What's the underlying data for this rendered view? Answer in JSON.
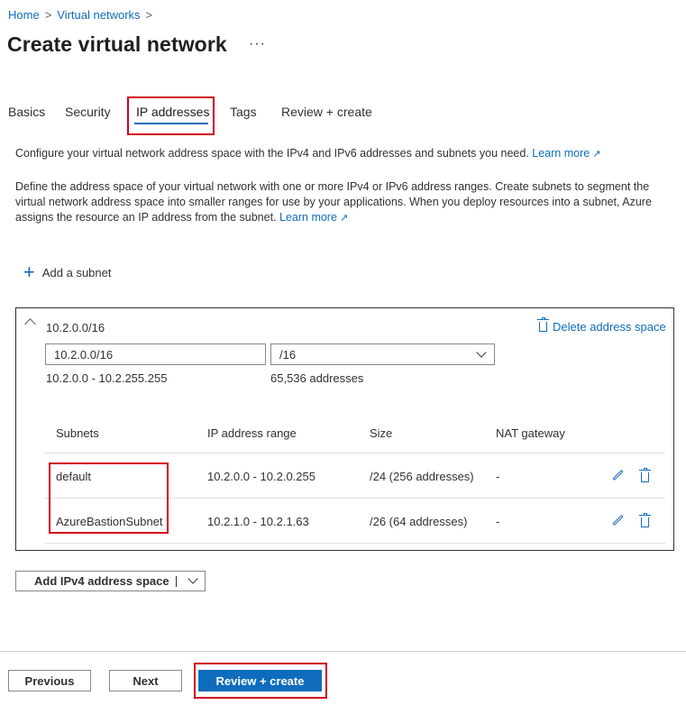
{
  "breadcrumb": {
    "home": "Home",
    "virtual_networks": "Virtual networks",
    "sep": ">"
  },
  "page": {
    "title": "Create virtual network",
    "more": "···"
  },
  "tabs": [
    {
      "label": "Basics",
      "active": false
    },
    {
      "label": "Security",
      "active": false
    },
    {
      "label": "IP addresses",
      "active": true
    },
    {
      "label": "Tags",
      "active": false
    },
    {
      "label": "Review + create",
      "active": false
    }
  ],
  "description": {
    "line1": "Configure your virtual network address space with the IPv4 and IPv6 addresses and subnets you need.",
    "line2": "Define the address space of your virtual network with one or more IPv4 or IPv6 address ranges. Create subnets to segment the virtual network address space into smaller ranges for use by your applications. When you deploy resources into a subnet, Azure assigns the resource an IP address from the subnet.",
    "learn_more": "Learn more"
  },
  "add_subnet": {
    "label": "Add a subnet",
    "icon": "plus-icon"
  },
  "address_space": {
    "header": "10.2.0.0/16",
    "delete_label": "Delete address space",
    "address_value": "10.2.0.0/16",
    "prefix_value": "/16",
    "range": "10.2.0.0 - 10.2.255.255",
    "count": "65,536 addresses"
  },
  "subnet_table": {
    "headers": [
      "Subnets",
      "IP address range",
      "Size",
      "NAT gateway"
    ],
    "rows": [
      {
        "name": "default",
        "range": "10.2.0.0 - 10.2.0.255",
        "size": "/24 (256 addresses)",
        "nat": "-"
      },
      {
        "name": "AzureBastionSubnet",
        "range": "10.2.1.0 - 10.2.1.63",
        "size": "/26 (64 addresses)",
        "nat": "-"
      }
    ]
  },
  "add_ipv4": {
    "label": "Add IPv4 address space"
  },
  "footer": {
    "previous": "Previous",
    "next": "Next",
    "review_create": "Review + create"
  },
  "colors": {
    "accent": "#0f6cbd",
    "highlight": "#d0021b"
  }
}
